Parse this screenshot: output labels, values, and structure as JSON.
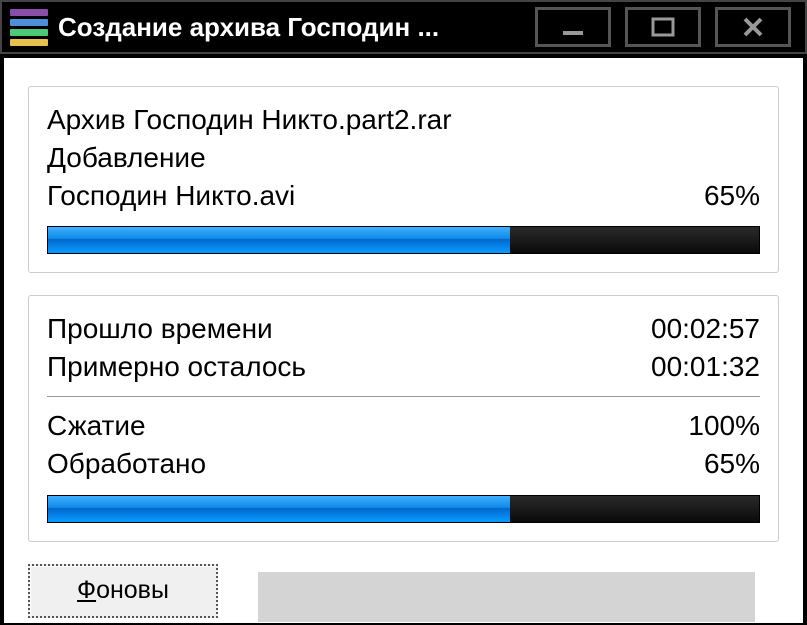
{
  "window": {
    "title": "Создание архива Господин ..."
  },
  "panel1": {
    "archive_label": "Архив",
    "archive_name": "Господин Никто.part2.rar",
    "operation": "Добавление",
    "file_name": "Господин Никто.avi",
    "file_percent": "65%",
    "progress_percent": 65
  },
  "panel2": {
    "elapsed_label": "Прошло времени",
    "elapsed_value": "00:02:57",
    "remaining_label": "Примерно осталось",
    "remaining_value": "00:01:32",
    "compression_label": "Сжатие",
    "compression_value": "100%",
    "processed_label": "Обработано",
    "processed_value": "65%",
    "progress_percent": 65
  },
  "buttons": {
    "background_prefix": "Ф",
    "background_suffix": "оновы"
  }
}
